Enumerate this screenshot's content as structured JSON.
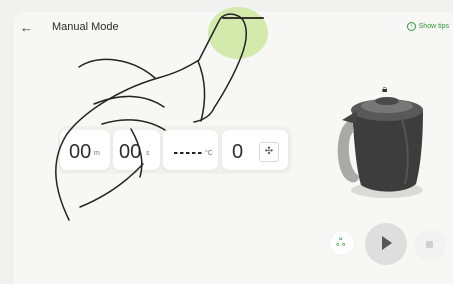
{
  "header": {
    "title": "Manual Mode",
    "show_tips": "Show tips"
  },
  "settings": {
    "minutes": "00",
    "minutes_unit": "m",
    "seconds": "00",
    "seconds_unit": "s",
    "temperature_unit": "°C",
    "fan_level": "0"
  },
  "colors": {
    "accent": "#2e9a3c",
    "green_highlight": "#cfe8a5"
  },
  "icons": [
    "back-arrow-icon",
    "info-icon",
    "lock-icon",
    "fan-icon",
    "mode-icon",
    "play-icon",
    "stop-icon",
    "hand-pointer-illustration",
    "kettle-image"
  ]
}
